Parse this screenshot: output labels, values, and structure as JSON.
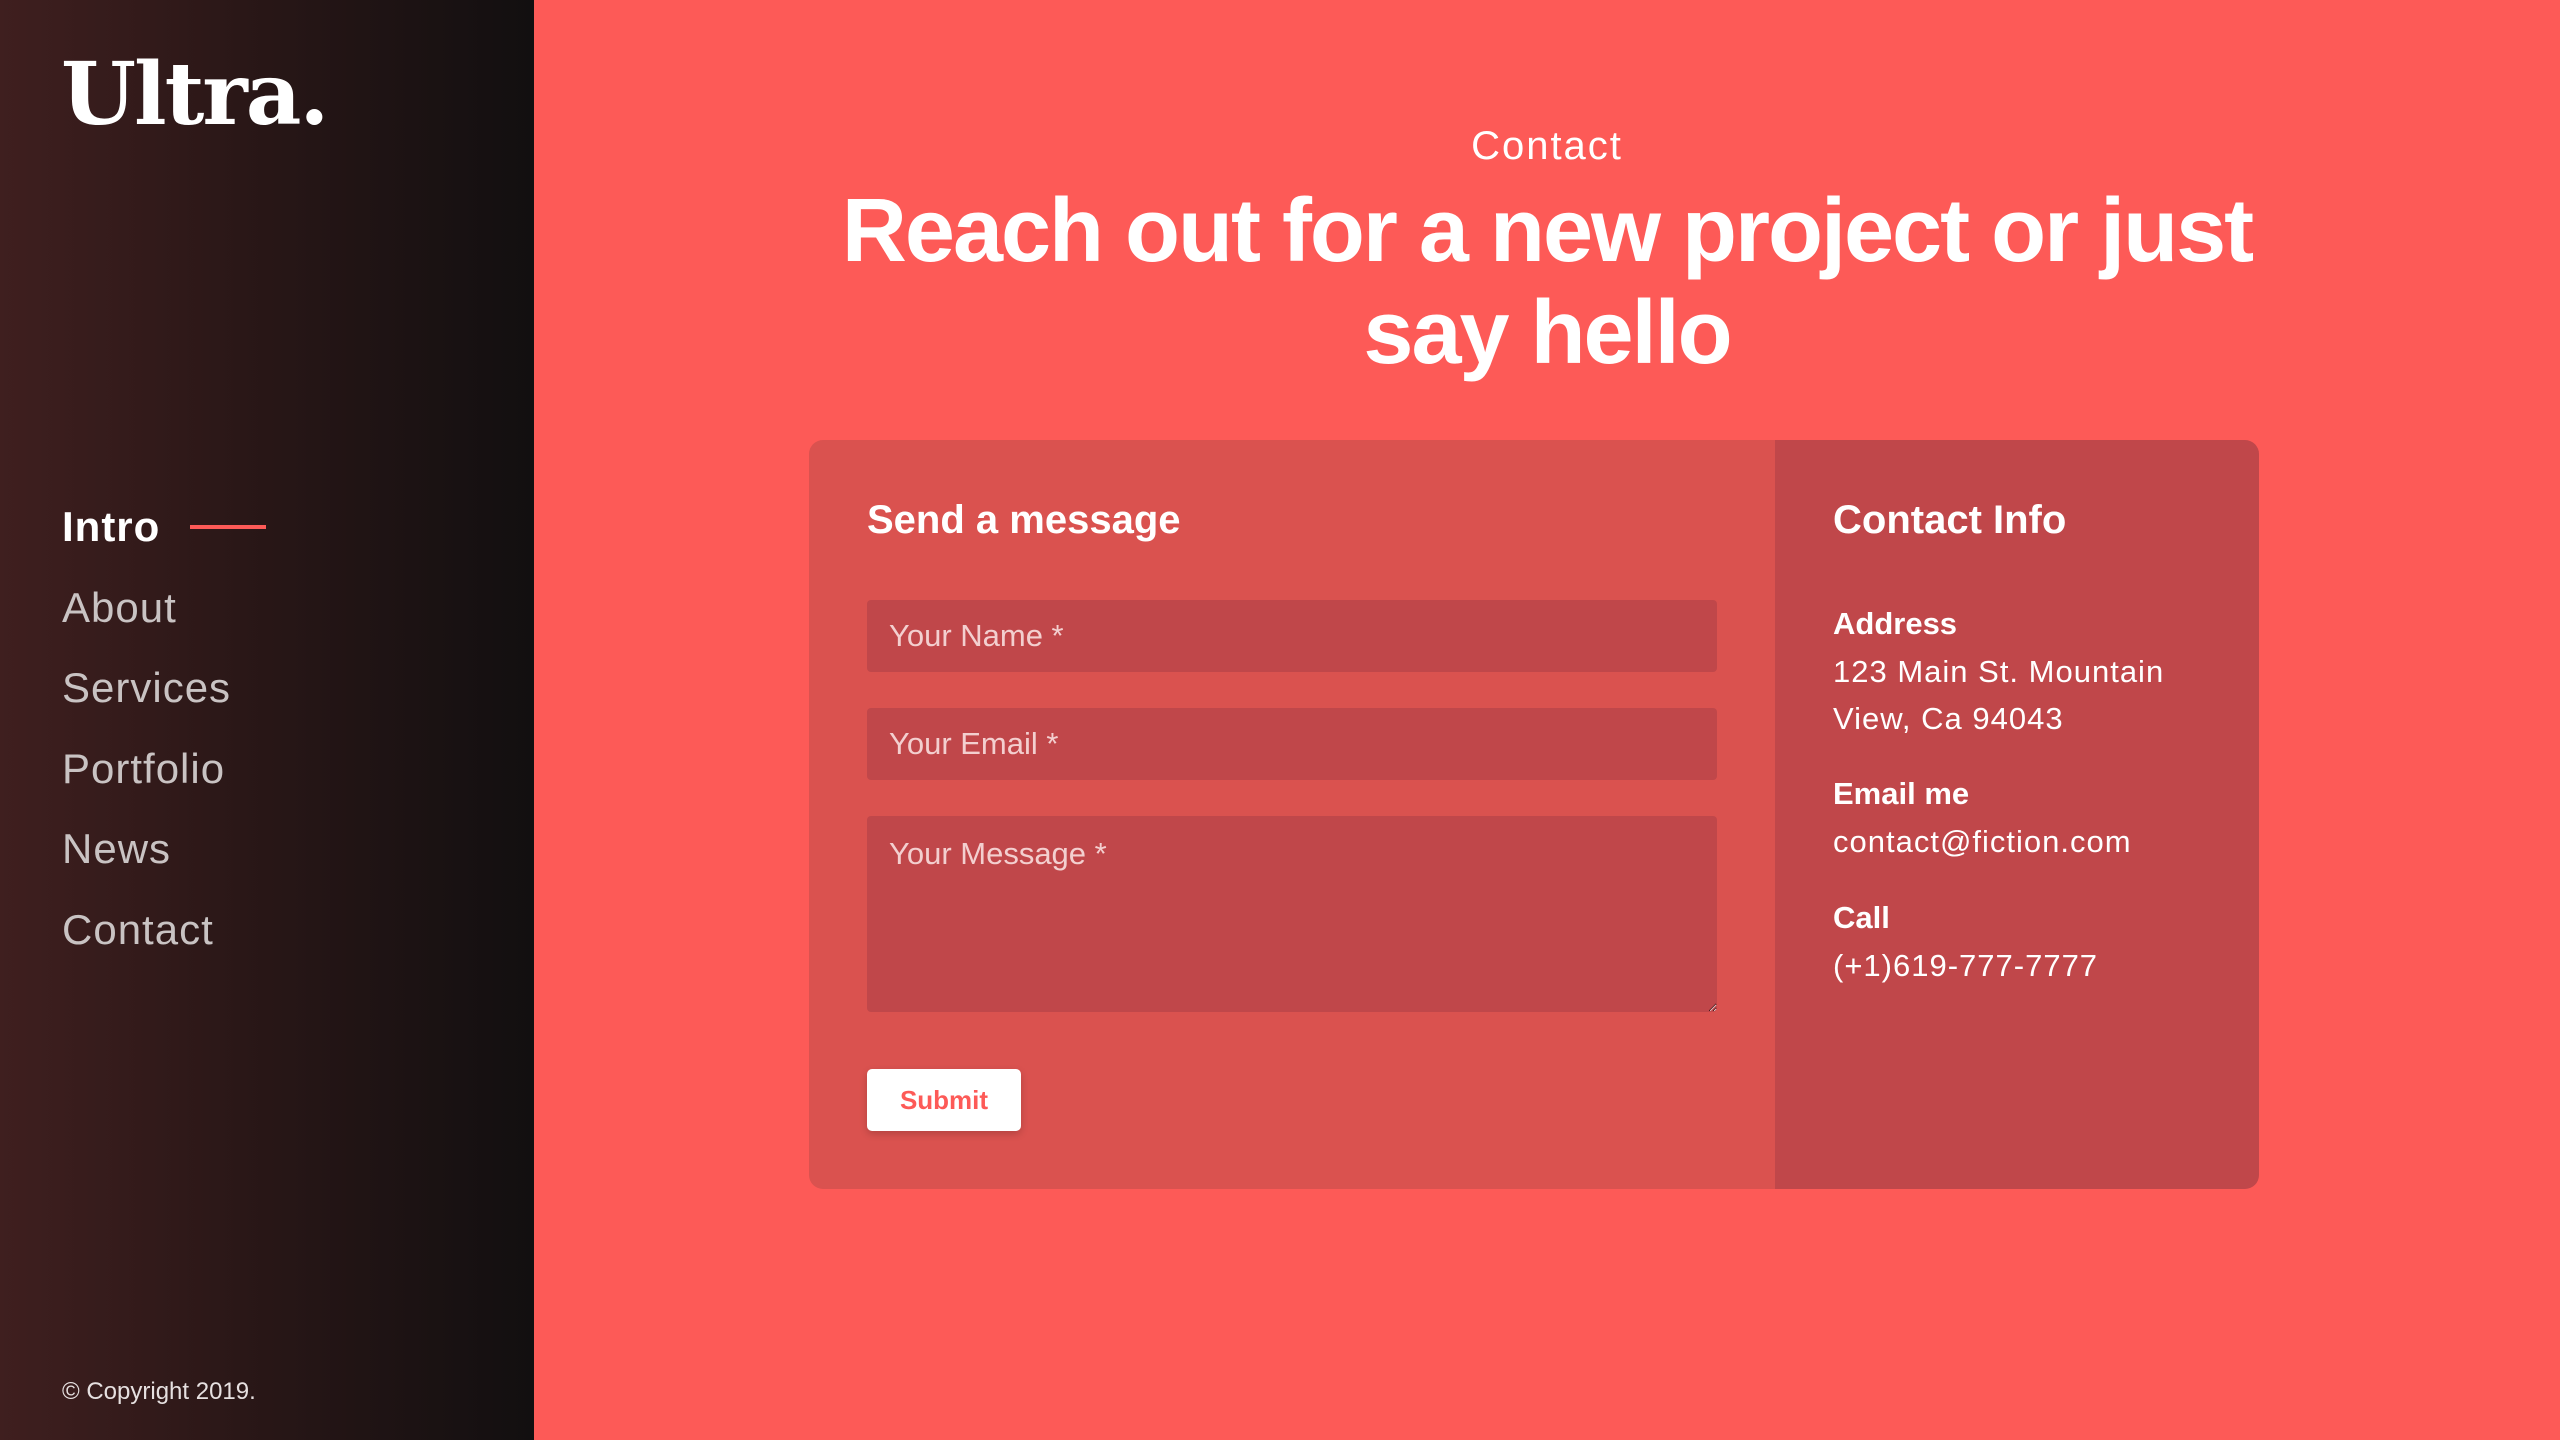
{
  "sidebar": {
    "logo": "Ultra.",
    "nav": [
      {
        "label": "Intro",
        "active": true
      },
      {
        "label": "About",
        "active": false
      },
      {
        "label": "Services",
        "active": false
      },
      {
        "label": "Portfolio",
        "active": false
      },
      {
        "label": "News",
        "active": false
      },
      {
        "label": "Contact",
        "active": false
      }
    ],
    "copyright": "© Copyright 2019."
  },
  "main": {
    "eyebrow": "Contact",
    "headline": "Reach out for a new project or just say hello"
  },
  "form": {
    "title": "Send a message",
    "name_placeholder": "Your Name *",
    "email_placeholder": "Your Email *",
    "message_placeholder": "Your Message *",
    "submit_label": "Submit"
  },
  "contact_info": {
    "title": "Contact Info",
    "address_label": "Address",
    "address_value": "123 Main St. Mountain View, Ca 94043",
    "email_label": "Email me",
    "email_value": "contact@fiction.com",
    "call_label": "Call",
    "call_value": "(+1)619-777-7777"
  },
  "colors": {
    "accent": "#fd5a57",
    "sidebar_dark": "#120f10",
    "form_pane": "#da524f",
    "info_pane": "#c0474a"
  }
}
